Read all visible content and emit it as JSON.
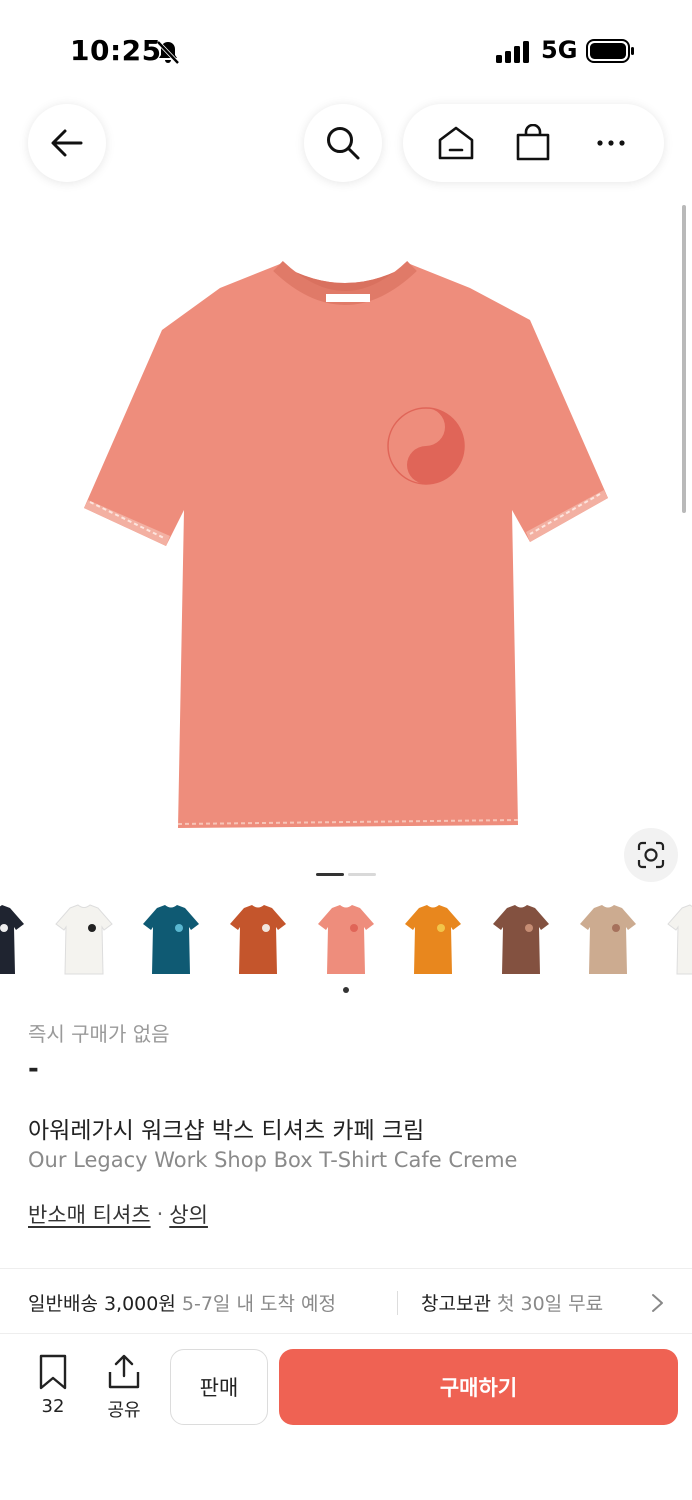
{
  "status_bar": {
    "time": "10:25",
    "network": "5G"
  },
  "nav": {
    "back_icon": "arrow-left-icon",
    "search_icon": "search-icon",
    "home_icon": "home-icon",
    "cart_icon": "shopping-bag-icon",
    "more_icon": "more-icon"
  },
  "product": {
    "image_icon": "tshirt-image",
    "page_indicator": {
      "count": 2,
      "active": 0
    },
    "thumbnails": [
      {
        "color": "#1f2430",
        "emblem": "#eeeeee"
      },
      {
        "color": "#f4f3ef",
        "emblem": "#222222"
      },
      {
        "color": "#0f5a73",
        "emblem": "#5ab7d0"
      },
      {
        "color": "#c4552c",
        "emblem": "#f1e6dd"
      },
      {
        "color": "#ee8d7c",
        "emblem": "#e06558"
      },
      {
        "color": "#e8871e",
        "emblem": "#f2c54a"
      },
      {
        "color": "#835140",
        "emblem": "#c68d74"
      },
      {
        "color": "#ccab90",
        "emblem": "#a6715c"
      },
      {
        "color": "#f4f3ef",
        "emblem": "#cfcfcf"
      }
    ],
    "instant_buy_status": "즉시 구매가 없음",
    "price": "-",
    "name_ko": "아워레가시 워크샵 박스 티셔츠 카페 크림",
    "name_en": "Our Legacy Work Shop Box T-Shirt Cafe Creme",
    "categories": [
      "반소매 티셔츠",
      "상의"
    ],
    "category_separator": "·"
  },
  "shipping": {
    "label": "일반배송 3,000원",
    "eta": "5-7일 내 도착 예정",
    "storage_label": "창고보관",
    "storage_note": "첫 30일 무료"
  },
  "bottom_bar": {
    "bookmark_count": "32",
    "share_label": "공유",
    "sell_label": "판매",
    "buy_label": "구매하기"
  },
  "colors": {
    "accent": "#ef6253",
    "shirt": "#ee8d7c"
  }
}
